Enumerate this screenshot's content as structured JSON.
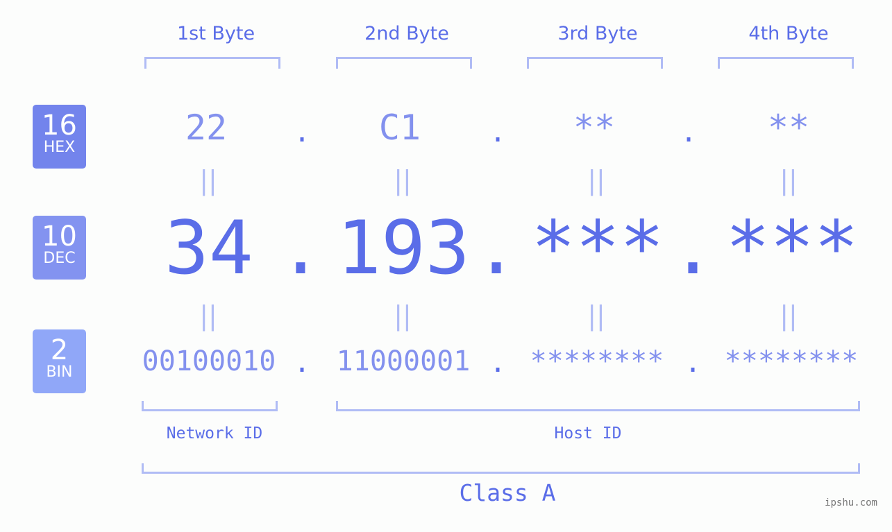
{
  "bytes": [
    {
      "label": "1st Byte",
      "hex": "22",
      "dec": "34",
      "bin": "00100010"
    },
    {
      "label": "2nd Byte",
      "hex": "C1",
      "dec": "193",
      "bin": "11000001"
    },
    {
      "label": "3rd Byte",
      "hex": "**",
      "dec": "***",
      "bin": "********"
    },
    {
      "label": "4th Byte",
      "hex": "**",
      "dec": "***",
      "bin": "********"
    }
  ],
  "separator": ".",
  "equals": "||",
  "badges": {
    "hex": {
      "num": "16",
      "label": "HEX",
      "color": "#7384ec"
    },
    "dec": {
      "num": "10",
      "label": "DEC",
      "color": "#8393f0"
    },
    "bin": {
      "num": "2",
      "label": "BIN",
      "color": "#90a7f8"
    }
  },
  "network_id_label": "Network ID",
  "host_id_label": "Host ID",
  "class_label": "Class A",
  "footer": "ipshu.com"
}
